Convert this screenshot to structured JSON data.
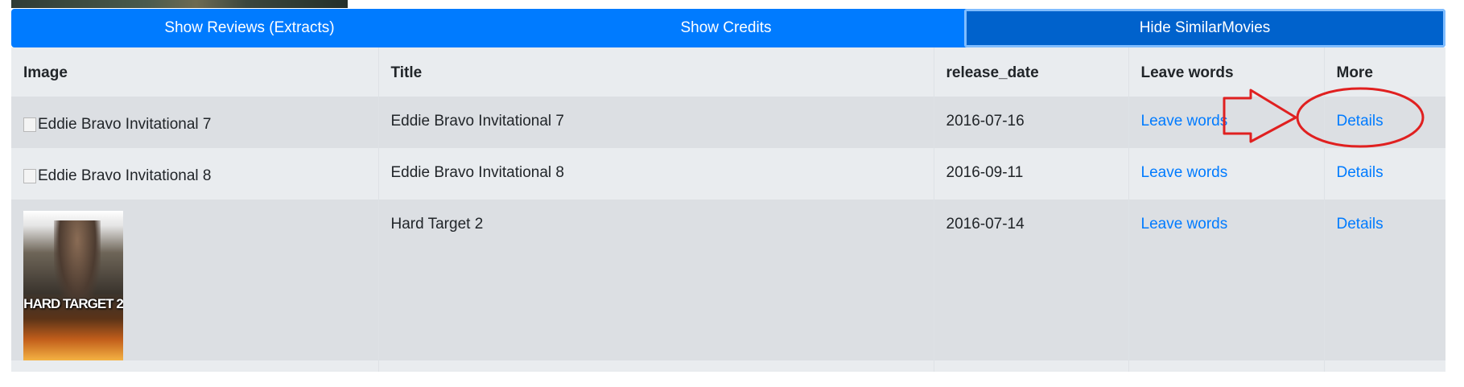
{
  "buttons": {
    "reviews": "Show Reviews (Extracts)",
    "credits": "Show Credits",
    "similar": "Hide SimilarMovies"
  },
  "table": {
    "headers": [
      "Image",
      "Title",
      "release_date",
      "Leave words",
      "More"
    ],
    "rows": [
      {
        "image_alt": "Eddie Bravo Invitational 7",
        "title": "Eddie Bravo Invitational 7",
        "release_date": "2016-07-16",
        "leave_words": "Leave words",
        "more": "Details"
      },
      {
        "image_alt": "Eddie Bravo Invitational 8",
        "title": "Eddie Bravo Invitational 8",
        "release_date": "2016-09-11",
        "leave_words": "Leave words",
        "more": "Details"
      },
      {
        "poster_text": "HARD TARGET 2",
        "title": "Hard Target 2",
        "release_date": "2016-07-14",
        "leave_words": "Leave words",
        "more": "Details"
      }
    ]
  },
  "colors": {
    "primary": "#007bff",
    "primary_active": "#0062cc",
    "annotation_red": "#e02020"
  },
  "annotation": {
    "type": "arrow-and-circle",
    "target": "first-row-details-link"
  }
}
